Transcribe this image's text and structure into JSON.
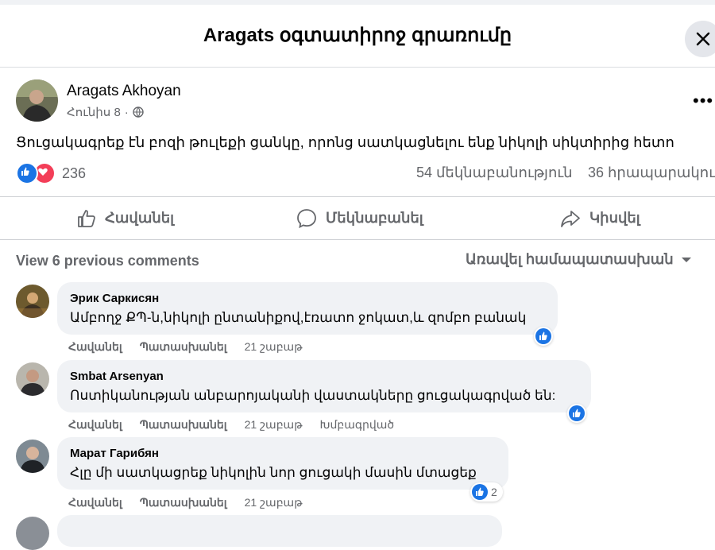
{
  "header": {
    "title": "Aragats օգտատիրոջ գրառումը"
  },
  "post": {
    "author": "Aragats Akhoyan",
    "date": "Հունիս 8",
    "text": "Ցուցակագրեք էն բոզի թուլեքի ցանկը, որոնց սատկացնելու ենք նիկոլի սիկտիրից հետո",
    "reaction_count": "236",
    "comments_count": "54 մեկնաբանություն",
    "shares_count": "36 հրապարակու"
  },
  "actions": {
    "like": "Հավանել",
    "comment": "Մեկնաբանել",
    "share": "Կիսվել"
  },
  "comments_bar": {
    "view_previous": "View 6 previous comments",
    "sort": "Առավել համապատասխան"
  },
  "comments": [
    {
      "author": "Эрик Саркисян",
      "text": "Ամբողջ ՔՊ-ն,նիկոլի ընտանիքով,էռատո ջոկատ,և զոմբո բանակ",
      "like": "Հավանել",
      "reply": "Պատասխանել",
      "time": "21 շաբաթ"
    },
    {
      "author": "Smbat Arsenyan",
      "text": "Ոստիկանության անբարոյականի վաստակները ցուցակագրված են:",
      "like": "Հավանել",
      "reply": "Պատասխանել",
      "time": "21 շաբաթ",
      "edited": "Խմբագրված"
    },
    {
      "author": "Марат Гарибян",
      "text": "Հլը մի սատկացրեք նիկոլին նոր ցուցակի մասին մտացեք",
      "like": "Հավանել",
      "reply": "Պատասխանել",
      "time": "21 շաբաթ",
      "reaction_count": "2"
    }
  ],
  "colors": {
    "accent": "#1b74e4",
    "love": "#f33e58",
    "secondary_text": "#65676b",
    "bubble": "#f0f2f5"
  }
}
